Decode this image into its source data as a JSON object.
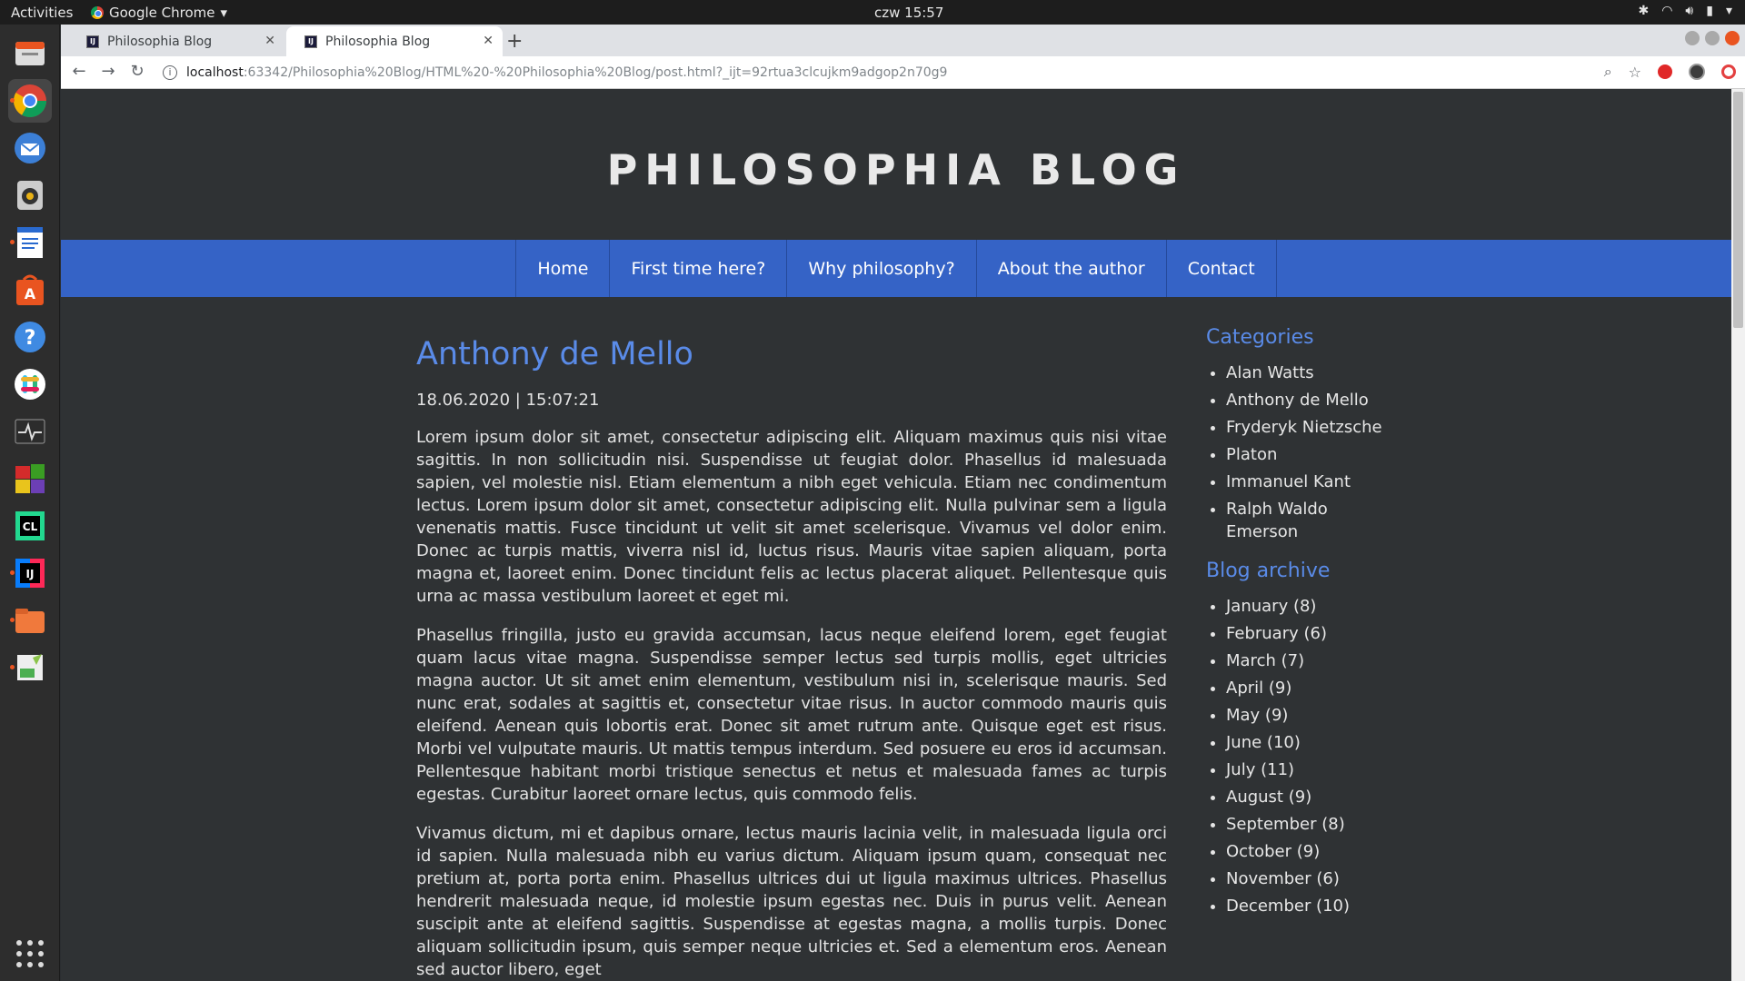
{
  "topbar": {
    "activities": "Activities",
    "app_name": "Google Chrome",
    "clock": "czw 15:57"
  },
  "browser": {
    "tabs": [
      {
        "title": "Philosophia Blog",
        "active": false
      },
      {
        "title": "Philosophia Blog",
        "active": true
      }
    ],
    "url_host": "localhost",
    "url_path": ":63342/Philosophia%20Blog/HTML%20-%20Philosophia%20Blog/post.html?_ijt=92rtua3clcujkm9adgop2n70g9"
  },
  "site": {
    "title": "PHILOSOPHIA BLOG",
    "nav": [
      "Home",
      "First time here?",
      "Why philosophy?",
      "About the author",
      "Contact"
    ]
  },
  "post": {
    "title": "Anthony de Mello",
    "date": "18.06.2020 | 15:07:21",
    "paragraphs": [
      "Lorem ipsum dolor sit amet, consectetur adipiscing elit. Aliquam maximus quis nisi vitae sagittis. In non sollicitudin nisi. Suspendisse ut feugiat dolor. Phasellus id malesuada sapien, vel molestie nisl. Etiam elementum a nibh eget vehicula. Etiam nec condimentum lectus. Lorem ipsum dolor sit amet, consectetur adipiscing elit. Nulla pulvinar sem a ligula venenatis mattis. Fusce tincidunt ut velit sit amet scelerisque. Vivamus vel dolor enim. Donec ac turpis mattis, viverra nisl id, luctus risus. Mauris vitae sapien aliquam, porta magna et, laoreet enim. Donec tincidunt felis ac lectus placerat aliquet. Pellentesque quis urna ac massa vestibulum laoreet et eget mi.",
      "Phasellus fringilla, justo eu gravida accumsan, lacus neque eleifend lorem, eget feugiat quam lacus vitae magna. Suspendisse semper lectus sed turpis mollis, eget ultricies magna auctor. Ut sit amet enim elementum, vestibulum nisi in, scelerisque mauris. Sed nunc erat, sodales at sagittis et, consectetur vitae risus. In auctor commodo mauris quis eleifend. Aenean quis lobortis erat. Donec sit amet rutrum ante. Quisque eget est risus. Morbi vel vulputate mauris. Ut mattis tempus interdum. Sed posuere eu eros id accumsan. Pellentesque habitant morbi tristique senectus et netus et malesuada fames ac turpis egestas. Curabitur laoreet ornare lectus, quis commodo felis.",
      "Vivamus dictum, mi et dapibus ornare, lectus mauris lacinia velit, in malesuada ligula orci id sapien. Nulla malesuada nibh eu varius dictum. Aliquam ipsum quam, consequat nec pretium at, porta porta enim. Phasellus ultrices dui ut ligula maximus ultrices. Phasellus hendrerit malesuada neque, id molestie ipsum egestas nec. Duis in purus velit. Aenean suscipit ante at eleifend sagittis. Suspendisse at egestas magna, a mollis turpis. Donec aliquam sollicitudin ipsum, quis semper neque ultricies et. Sed a elementum eros. Aenean sed auctor libero, eget"
    ]
  },
  "sidebar": {
    "categories_heading": "Categories",
    "categories": [
      "Alan Watts",
      "Anthony de Mello",
      "Fryderyk Nietzsche",
      "Platon",
      "Immanuel Kant",
      "Ralph Waldo Emerson"
    ],
    "archive_heading": "Blog archive",
    "archive": [
      "January (8)",
      "February (6)",
      "March (7)",
      "April (9)",
      "May (9)",
      "June (10)",
      "July (11)",
      "August (9)",
      "September (8)",
      "October (9)",
      "November (6)",
      "December (10)"
    ]
  },
  "dock": {
    "items": [
      "files-icon",
      "chrome-icon",
      "thunderbird-icon",
      "rhythmbox-icon",
      "writer-icon",
      "software-center-icon",
      "help-icon",
      "slack-icon",
      "system-monitor-icon",
      "color-app-icon",
      "clion-icon",
      "intellij-icon",
      "folder-icon",
      "notes-icon"
    ]
  },
  "colors": {
    "nav_bg": "#3563c6",
    "accent": "#5a8be8",
    "page_bg": "#2f3234"
  }
}
